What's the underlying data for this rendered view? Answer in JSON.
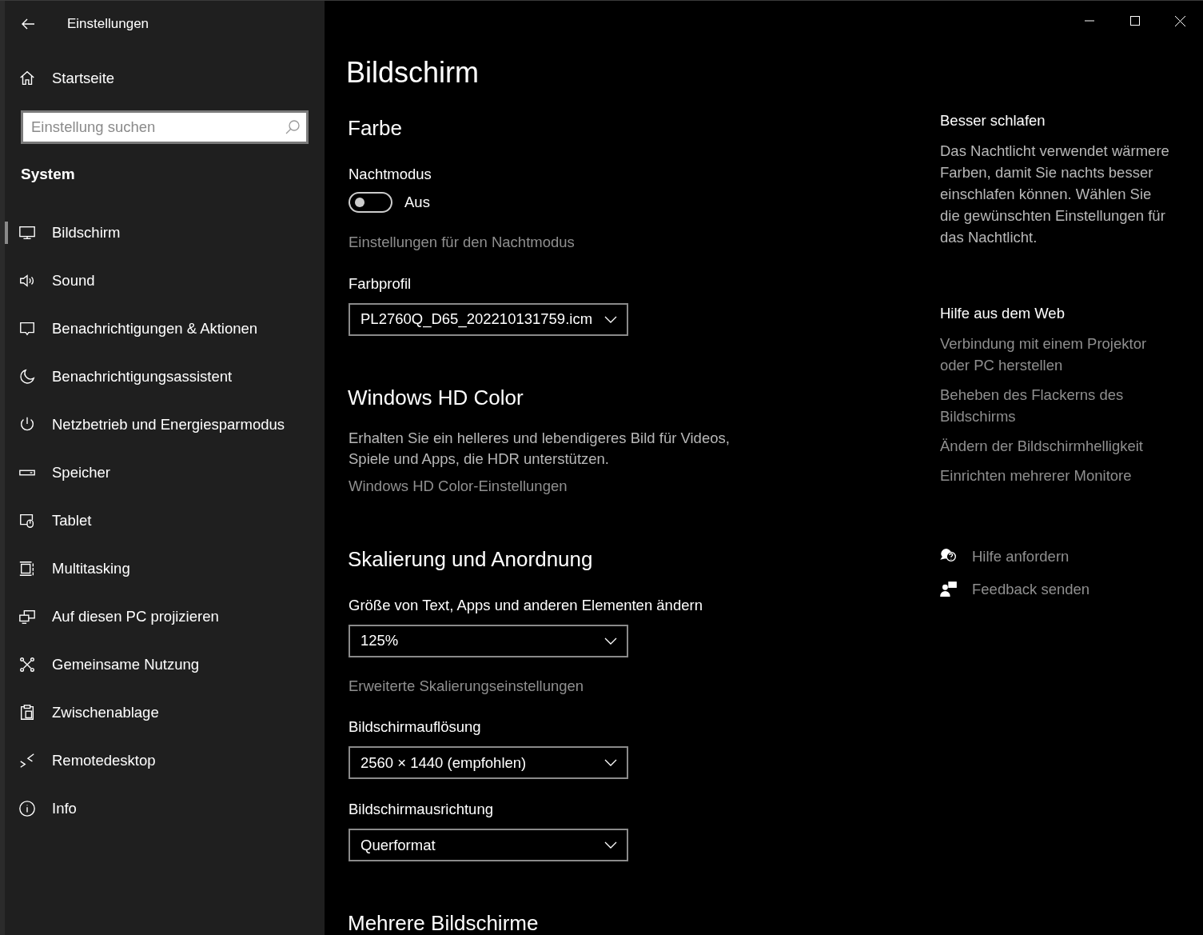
{
  "window": {
    "title": "Einstellungen"
  },
  "sidebar": {
    "home": "Startseite",
    "search": {
      "placeholder": "Einstellung suchen"
    },
    "section": "System",
    "items": [
      {
        "label": "Bildschirm",
        "selected": true
      },
      {
        "label": "Sound",
        "selected": false
      },
      {
        "label": "Benachrichtigungen & Aktionen",
        "selected": false
      },
      {
        "label": "Benachrichtigungsassistent",
        "selected": false
      },
      {
        "label": "Netzbetrieb und Energiesparmodus",
        "selected": false
      },
      {
        "label": "Speicher",
        "selected": false
      },
      {
        "label": "Tablet",
        "selected": false
      },
      {
        "label": "Multitasking",
        "selected": false
      },
      {
        "label": "Auf diesen PC projizieren",
        "selected": false
      },
      {
        "label": "Gemeinsame Nutzung",
        "selected": false
      },
      {
        "label": "Zwischenablage",
        "selected": false
      },
      {
        "label": "Remotedesktop",
        "selected": false
      },
      {
        "label": "Info",
        "selected": false
      }
    ]
  },
  "page": {
    "title": "Bildschirm",
    "blocks": [
      {
        "kind": "heading",
        "text": "Farbe"
      },
      {
        "kind": "label",
        "text": "Nachtmodus"
      },
      {
        "kind": "toggle",
        "on": false,
        "text": "Aus"
      },
      {
        "kind": "link",
        "text": "Einstellungen für den Nachtmodus"
      },
      {
        "kind": "label",
        "text": "Farbprofil"
      },
      {
        "kind": "dropdown",
        "value": "PL2760Q_D65_202210131759.icm"
      },
      {
        "kind": "heading",
        "text": "Windows HD Color"
      },
      {
        "kind": "paragraph",
        "text": "Erhalten Sie ein helleres und lebendigeres Bild für Videos, Spiele und Apps, die HDR unterstützen."
      },
      {
        "kind": "link",
        "text": "Windows HD Color-Einstellungen"
      },
      {
        "kind": "heading",
        "text": "Skalierung und Anordnung"
      },
      {
        "kind": "label",
        "text": "Größe von Text, Apps und anderen Elementen ändern"
      },
      {
        "kind": "dropdown",
        "value": "125%"
      },
      {
        "kind": "link",
        "text": "Erweiterte Skalierungseinstellungen"
      },
      {
        "kind": "label",
        "text": "Bildschirmauflösung"
      },
      {
        "kind": "dropdown",
        "value": "2560 × 1440 (empfohlen)"
      },
      {
        "kind": "label",
        "text": "Bildschirmausrichtung"
      },
      {
        "kind": "dropdown",
        "value": "Querformat"
      },
      {
        "kind": "heading",
        "text": "Mehrere Bildschirme"
      }
    ]
  },
  "aside": {
    "tip": {
      "title": "Besser schlafen",
      "text": "Das Nachtlicht verwendet wärmere Farben, damit Sie nachts besser einschlafen können. Wählen Sie die gewünschten Einstellungen für das Nachtlicht."
    },
    "help": {
      "title": "Hilfe aus dem Web",
      "links": [
        "Verbindung mit einem Projektor oder PC herstellen",
        "Beheben des Flackerns des Bildschirms",
        "Ändern der Bildschirmhelligkeit",
        "Einrichten mehrerer Monitore"
      ]
    },
    "actions": [
      "Hilfe anfordern",
      "Feedback senden"
    ]
  }
}
